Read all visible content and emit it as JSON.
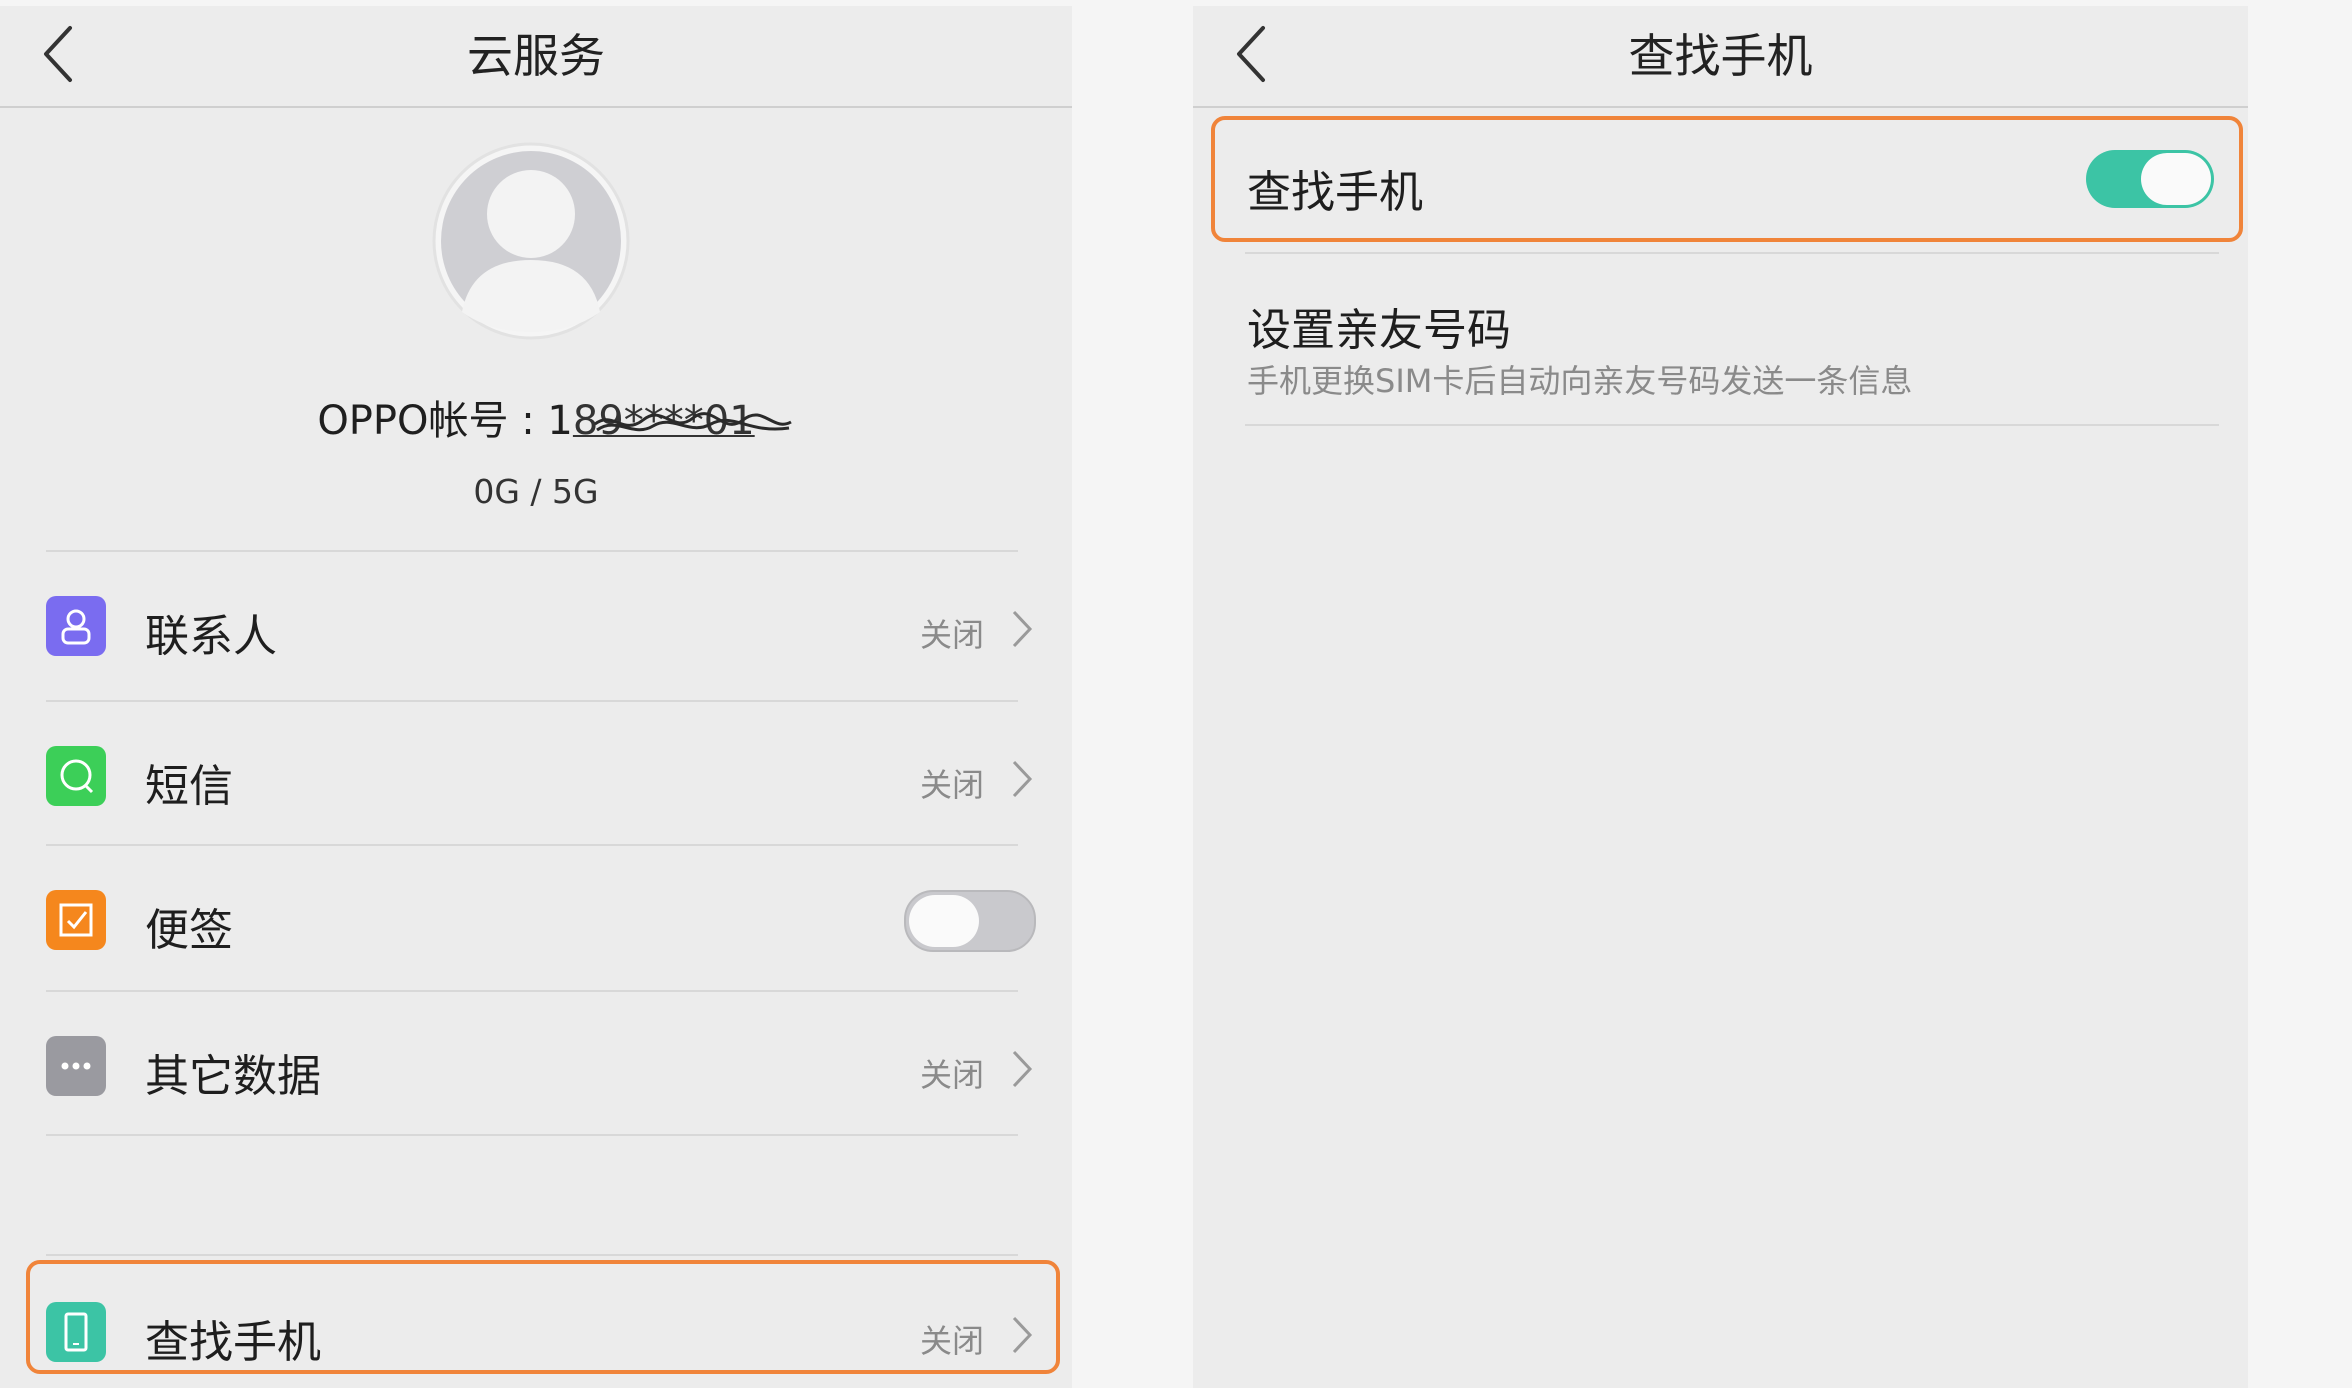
{
  "left": {
    "title": "云服务",
    "account_prefix": "OPPO帐号 : 1",
    "account_masked": "89****01",
    "storage": "0G / 5G",
    "items": [
      {
        "label": "联系人",
        "status": "关闭",
        "icon": "contacts-icon",
        "color": "#7a6cf0"
      },
      {
        "label": "短信",
        "status": "关闭",
        "icon": "message-icon",
        "color": "#3ccf58"
      },
      {
        "label": "便签",
        "toggle": "off",
        "icon": "notes-icon",
        "color": "#f5871d"
      },
      {
        "label": "其它数据",
        "status": "关闭",
        "icon": "more-icon",
        "color": "#9a9aa0"
      }
    ],
    "find_phone": {
      "label": "查找手机",
      "status": "关闭",
      "icon": "phone-icon",
      "color": "#3cc4a5"
    }
  },
  "right": {
    "title": "查找手机",
    "find_phone_label": "查找手机",
    "find_phone_toggle": "on",
    "family_label": "设置亲友号码",
    "family_desc": "手机更换SIM卡后自动向亲友号码发送一条信息"
  },
  "colors": {
    "highlight": "#f0843a",
    "toggle_on": "#3cc4a5",
    "toggle_off": "#c9c9cd"
  }
}
